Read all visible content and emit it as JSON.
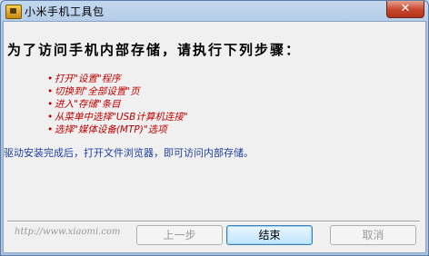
{
  "window": {
    "title": "小米手机工具包",
    "close_label": "✕"
  },
  "content": {
    "heading": "为了访问手机内部存储，请执行下列步骤：",
    "bullet": "•",
    "steps": [
      "打开\"设置\"程序",
      "切换到\"全部设置\"页",
      "进入\"存储\"条目",
      "从菜单中选择\"USB计算机连接\"",
      "选择\"媒体设备(MTP)\"选项"
    ],
    "note": "驱动安装完成后，打开文件浏览器，即可访问内部存储。"
  },
  "footer": {
    "url": "http://www.xiaomi.com",
    "prev_label": "上一步",
    "finish_label": "结束",
    "cancel_label": "取消"
  }
}
